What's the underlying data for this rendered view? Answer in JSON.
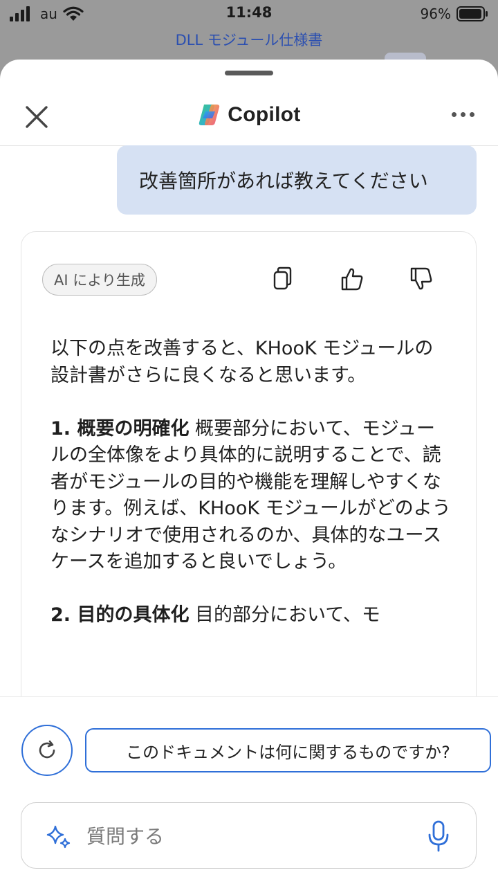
{
  "status_bar": {
    "carrier": "au",
    "time": "11:48",
    "battery": "96%"
  },
  "background_page": {
    "title": "DLL モジュール仕様書"
  },
  "header": {
    "brand": "Copilot",
    "close_icon": "close-icon",
    "more_icon": "more-horizontal-icon"
  },
  "chat": {
    "user_message": "改善箇所があれば教えてください",
    "ai_badge": "AI により生成",
    "actions": [
      "copy-icon",
      "thumbs-up-icon",
      "thumbs-down-icon"
    ],
    "answer": {
      "intro": "以下の点を改善すると、KHooK モジュールの設計書がさらに良くなると思います。",
      "item1_title": "1. 概要の明確化",
      "item1_text": " 概要部分において、モジュールの全体像をより具体的に説明することで、読者がモジュールの目的や機能を理解しやすくなります。例えば、KHooK モジュールがどのようなシナリオで使用されるのか、具体的なユースケースを追加すると良いでしょう。",
      "item2_title": "2. 目的の具体化",
      "item2_text": " 目的部分において、モ"
    }
  },
  "bottom": {
    "suggestion": "このドキュメントは何に関するものですか?",
    "input_placeholder": "質問する"
  },
  "colors": {
    "accent": "#2f6fd8",
    "user_bubble": "#d6e1f3",
    "background_title": "#2b4fb0"
  }
}
